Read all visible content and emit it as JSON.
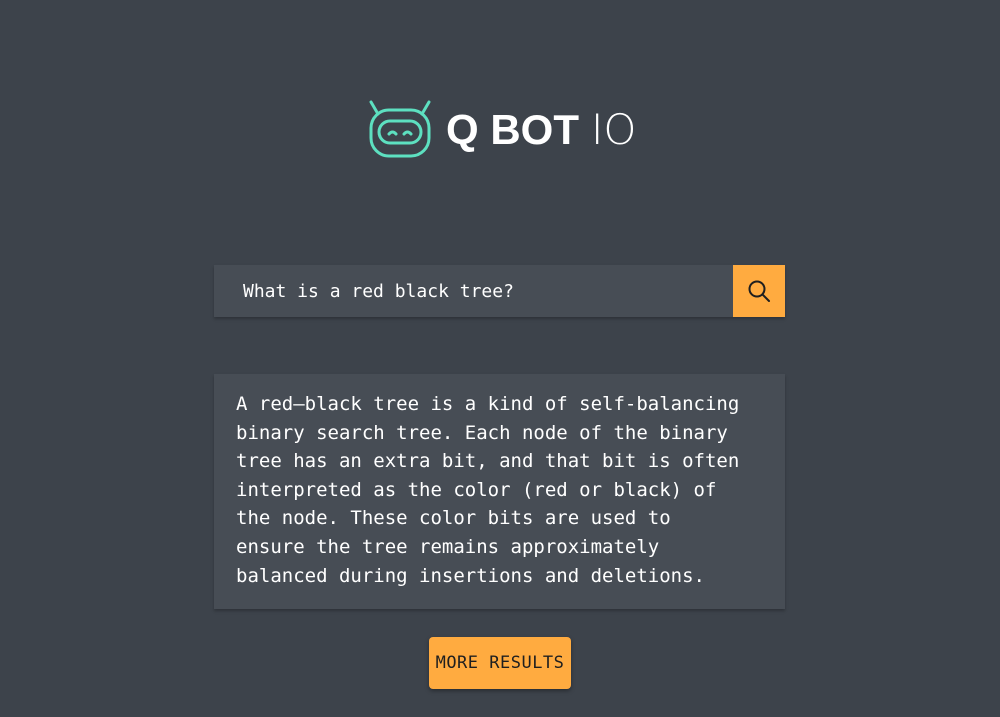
{
  "brand": {
    "name": "Q BOT",
    "suffix": "IO",
    "logo_icon": "robot-icon",
    "accent_color": "#5de0c0"
  },
  "search": {
    "value": "What is a red black tree?",
    "button_icon": "search-icon",
    "button_color": "#ffab40"
  },
  "answer": {
    "text": "A red–black tree is a kind of self-balancing\nbinary search tree. Each node of the binary\ntree has an extra bit, and that bit is often\ninterpreted as the color (red or black) of\nthe node. These color bits are used to\nensure the tree remains approximately\nbalanced during insertions and deletions."
  },
  "actions": {
    "more_results_label": "MORE RESULTS"
  },
  "colors": {
    "background": "#3d434b",
    "panel": "#474d55",
    "accent": "#ffab40"
  }
}
